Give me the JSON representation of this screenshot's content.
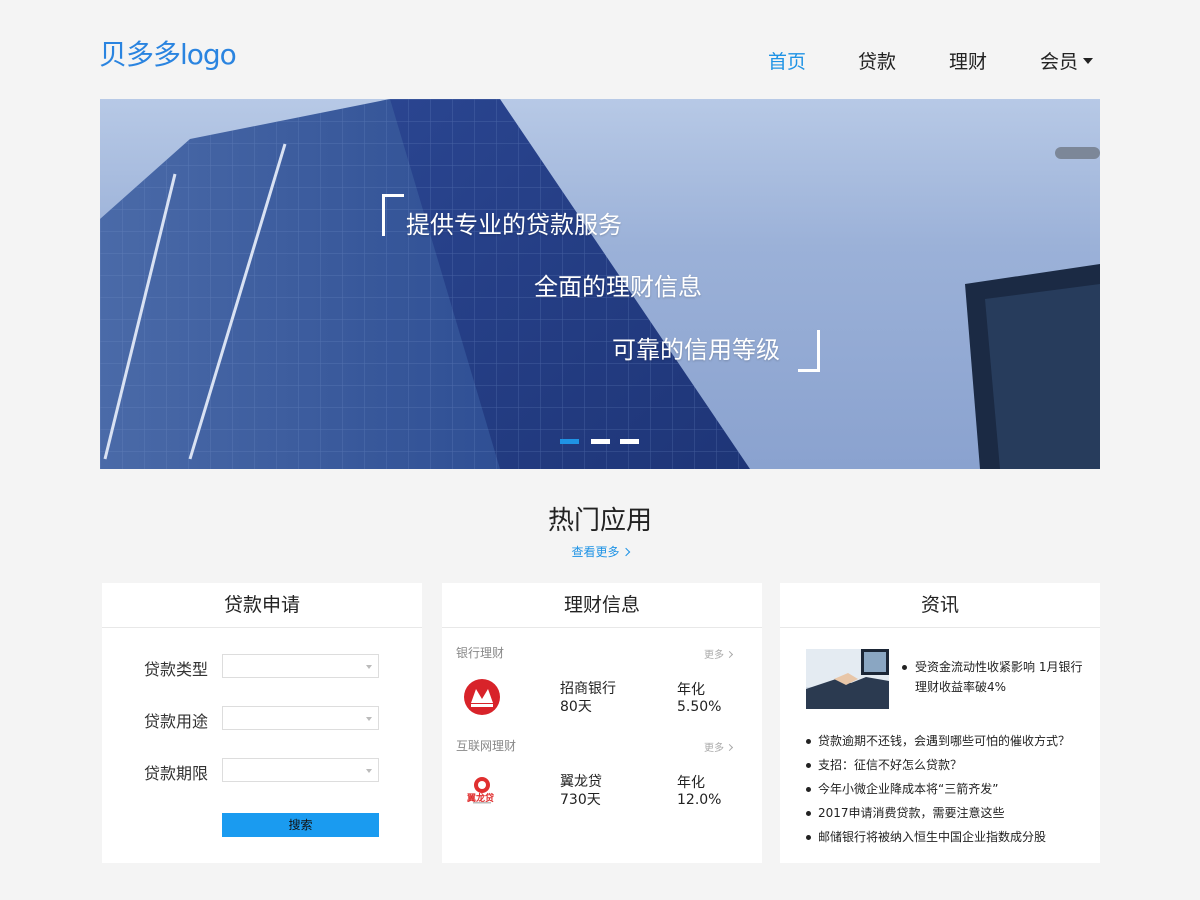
{
  "header": {
    "logo": "贝多多logo",
    "nav": [
      {
        "label": "首页",
        "active": true
      },
      {
        "label": "贷款",
        "active": false
      },
      {
        "label": "理财",
        "active": false
      },
      {
        "label": "会员",
        "active": false,
        "dropdown": true
      }
    ]
  },
  "banner": {
    "lines": [
      "提供专业的贷款服务",
      "全面的理财信息",
      "可靠的信用等级"
    ],
    "slide_count": 3,
    "active_slide": 1
  },
  "section": {
    "title": "热门应用",
    "more": "查看更多"
  },
  "loan": {
    "title": "贷款申请",
    "fields": [
      {
        "label": "贷款类型",
        "value": ""
      },
      {
        "label": "贷款用途",
        "value": ""
      },
      {
        "label": "贷款期限",
        "value": ""
      }
    ],
    "button": "搜索"
  },
  "finance": {
    "title": "理财信息",
    "groups": [
      {
        "heading": "银行理财",
        "more": "更多",
        "item": {
          "logo": "cmb-bank-logo",
          "name": "招商银行",
          "term": "80天",
          "rate_label": "年化",
          "rate": "5.50%"
        }
      },
      {
        "heading": "互联网理财",
        "more": "更多",
        "item": {
          "logo": "yilongdai-logo",
          "logo_text": "翼龙贷",
          "name": "翼龙贷",
          "term": "730天",
          "rate_label": "年化",
          "rate": "12.0%"
        }
      }
    ]
  },
  "news": {
    "title": "资讯",
    "featured": "受资金流动性收紧影响 1月银行理财收益率破4%",
    "items": [
      "贷款逾期不还钱，会遇到哪些可怕的催收方式？",
      "支招：征信不好怎么贷款？",
      "今年小微企业降成本将“三箭齐发”",
      "2017申请消费贷款，需要注意这些",
      "邮储银行将被纳入恒生中国企业指数成分股"
    ]
  },
  "colors": {
    "accent": "#1f93e5",
    "logo": "#2a84e0",
    "page_bg": "#f4f4f4",
    "button": "#1a9bf0"
  }
}
